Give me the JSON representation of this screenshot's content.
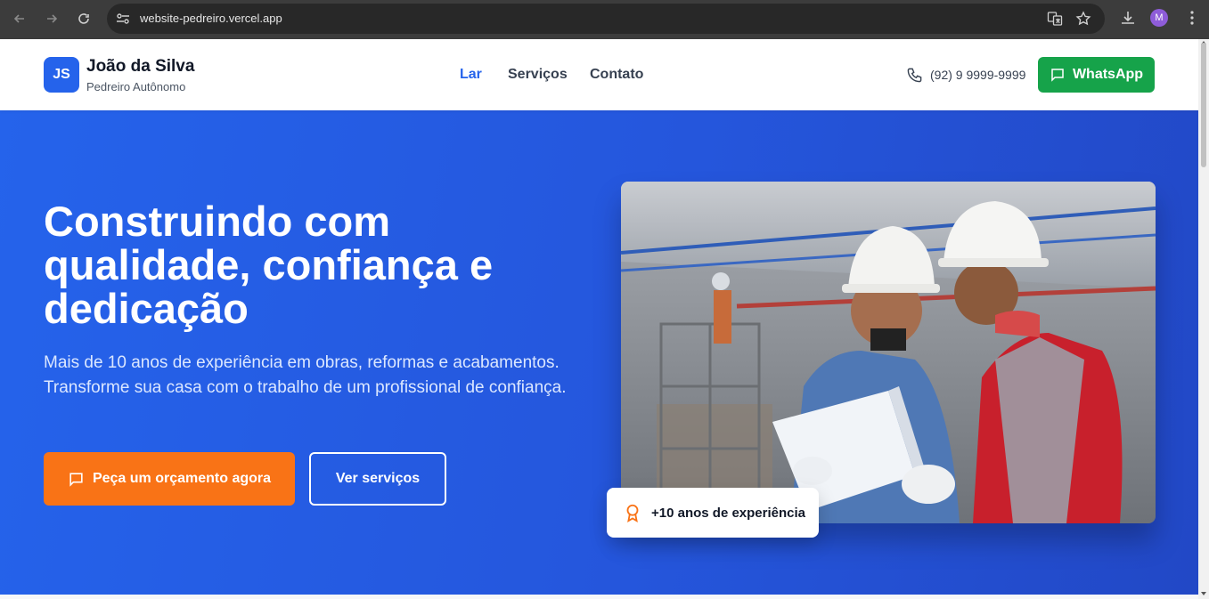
{
  "browser": {
    "url": "website-pedreiro.vercel.app",
    "profile_initial": "M",
    "icons": [
      "back-icon",
      "forward-icon",
      "reload-icon",
      "site-settings-icon",
      "translate-icon",
      "bookmark-star-icon",
      "download-icon",
      "menu-dots-icon"
    ]
  },
  "header": {
    "logo_initials": "JS",
    "brand_name": "João da Silva",
    "brand_subtitle": "Pedreiro Autônomo",
    "nav": [
      {
        "label": "Lar",
        "active": true
      },
      {
        "label": "Serviços",
        "active": false
      },
      {
        "label": "Contato",
        "active": false
      }
    ],
    "phone": "(92) 9 9999-9999",
    "whatsapp_label": "WhatsApp"
  },
  "hero": {
    "title": "Construindo com qualidade, confiança e dedicação",
    "lead": "Mais de 10 anos de experiência em obras, reformas e acabamentos. Transforme sua casa com o trabalho de um profissional de confiança.",
    "primary_cta": "Peça um orçamento agora",
    "secondary_cta": "Ver serviços",
    "badge_text": "+10 anos de experiência"
  },
  "colors": {
    "primary_blue": "#2563eb",
    "whatsapp_green": "#16a34a",
    "cta_orange": "#f97316"
  }
}
